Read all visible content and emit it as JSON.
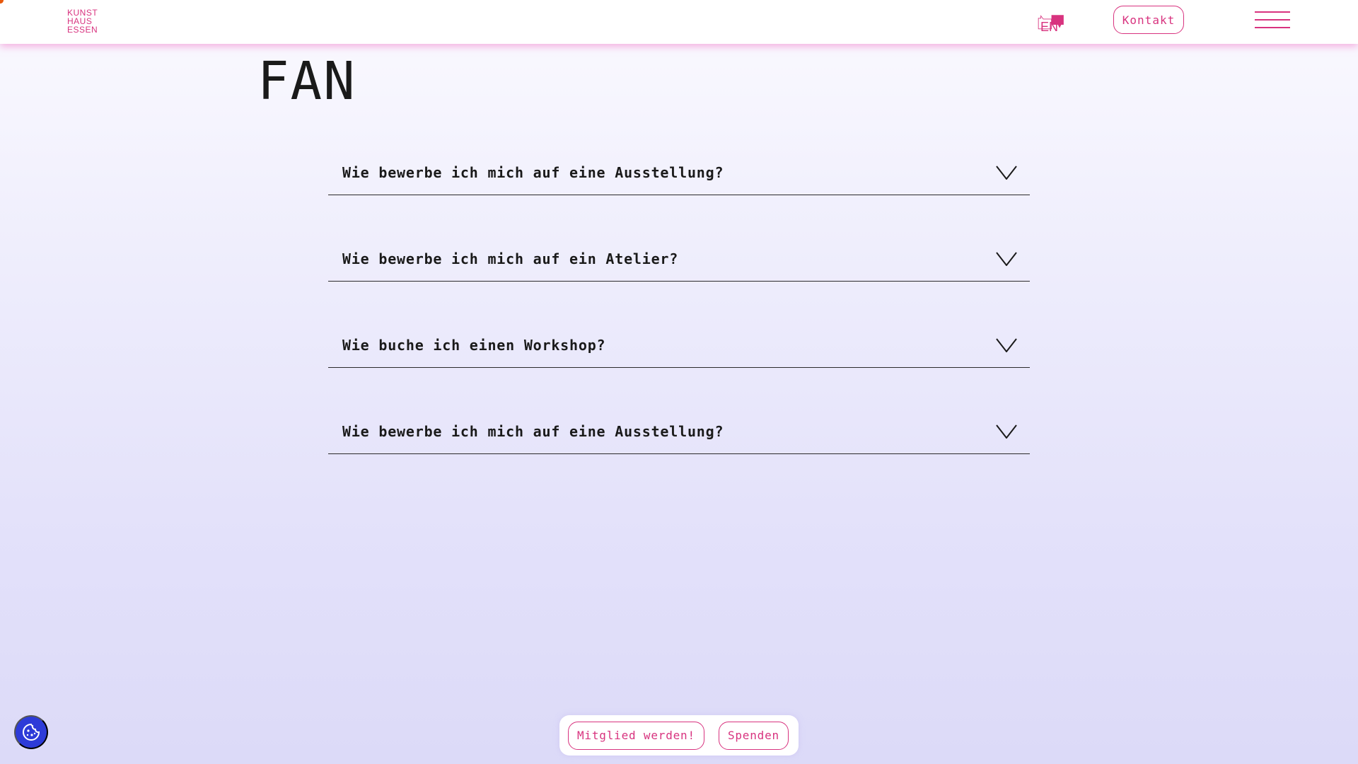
{
  "header": {
    "logo_lines": [
      "KUNST",
      "HAUS",
      "ESSEN"
    ],
    "lang": {
      "en_label": "EN",
      "de_label": "DE"
    },
    "contact_label": "Kontakt"
  },
  "page": {
    "title": "FAN"
  },
  "faq": {
    "items": [
      {
        "question": "Wie bewerbe ich mich auf eine Ausstellung?"
      },
      {
        "question": "Wie bewerbe ich mich auf ein Atelier?"
      },
      {
        "question": "Wie buche ich einen Workshop?"
      },
      {
        "question": "Wie bewerbe ich mich auf eine Ausstellung?"
      }
    ]
  },
  "actions": {
    "member_label": "Mitglied werden!",
    "donate_label": "Spenden"
  },
  "colors": {
    "accent": "#d8337f",
    "cookie_button": "#2d3bd8",
    "text": "#1a1a1a"
  },
  "icons": {
    "menu": "hamburger-icon",
    "chevron": "chevron-down-icon",
    "cookie": "cookie-icon",
    "language": "language-switch-icon"
  }
}
